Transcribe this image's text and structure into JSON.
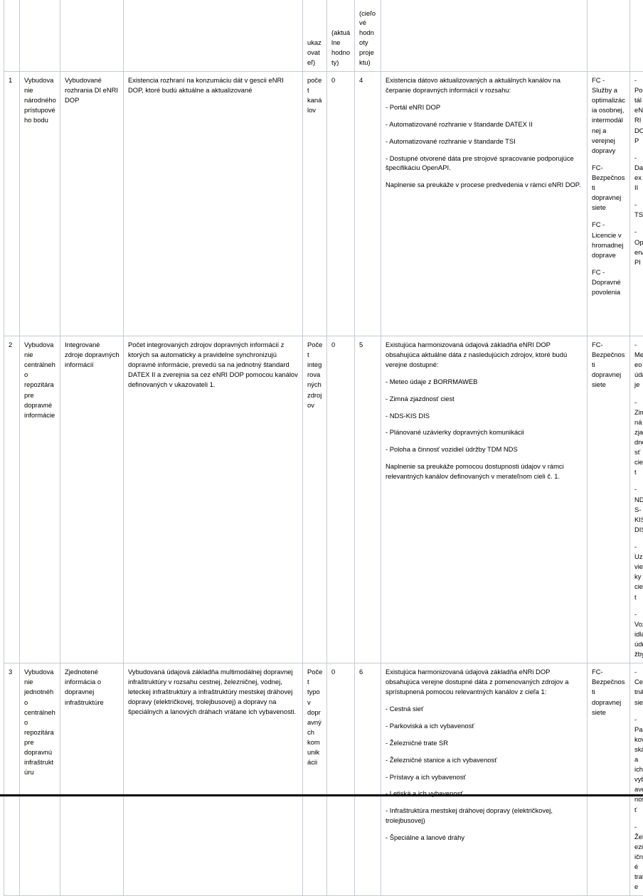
{
  "table": {
    "header": {
      "unit": "ukazovateľ)",
      "baseline": "(aktuálne hodnoty)",
      "target": "(cieľové hodnoty projektu)"
    },
    "rows": [
      {
        "num": "1",
        "goal": "Vybudovanie národného prístupového bodu",
        "name": "Vybudované rozhrania DI eNRI DOP",
        "description": "Existencia rozhraní na konzumáciu dát v gescii eNRI DOP, ktoré budú aktuálne a aktualizované",
        "unit": "počet kanálov",
        "baseline": "0",
        "target": "4",
        "measurement": [
          "Existencia dátovo aktualizovaných a aktuálnych kanálov na čerpanie dopravných informácií v rozsahu:",
          "- Portál eNRI DOP",
          "- Automatizované rozhranie v štandarde DATEX II",
          "- Automatizované rozhranie v štandarde TSI",
          "- Dostupné otvorené dáta pre strojové spracovanie podporujúce špecifikáciu OpenAPI.",
          "Naplnenie sa preukáže v procese predvedenia v rámci eNRI DOP."
        ],
        "fc": [
          "FC - Služby a optimalizácia osobnej, intermodálnej a verejnej dopravy",
          "FC-Bezpečnosti dopravnej siete",
          "FC - Licencie v hromadnej doprave",
          "FC - Dopravné povolenia"
        ],
        "outputs": [
          "- Portál eNRI DOP",
          "- Datex II",
          "- TSI",
          "- OpenAPI"
        ]
      },
      {
        "num": "2",
        "goal": "Vybudovanie centrálneho repozitára pre dopravné informácie",
        "name": "Integrované zdroje dopravných informácií",
        "description": "Počet integrovaných zdrojov dopravných informácií z ktorých sa automaticky a pravidelne synchronizujú dopravné informácie, prevedú sa na jednotný štandard DATEX II a zverejnia sa cez eNRI DOP pomocou kanálov definovaných v ukazovateli 1.",
        "unit": "Počet integrovaných zdrojov",
        "baseline": "0",
        "target": "5",
        "measurement": [
          "Existujúca harmonizovaná údajová základňa eNRI DOP obsahujúca aktuálne dáta z nasledujúcich zdrojov, ktoré budú verejne dostupné:",
          "- Meteo údaje z BORRMAWEB",
          "- Zimná zjazdnosť ciest",
          "- NDS-KIS DIS",
          "- Plánované uzávierky dopravných komunikácii",
          "- Poloha a činnosť vozidiel údržby TDM NDS",
          "Naplnenie sa preukáže pomocou dostupnosti údajov v rámci relevantných kanálov definovaných v merateľnom cieli č. 1."
        ],
        "fc": [
          "FC-Bezpečnosti dopravnej siete"
        ],
        "outputs": [
          "- Meteo údaje",
          "- Zimná zjazdnosť ciest",
          "- NDS-KIS DIS",
          "- Uzávierky ciest",
          "- Vozidlá údržby"
        ]
      },
      {
        "num": "3",
        "goal": "Vybudovanie jednotného centrálneho repozitára pre dopravnú infraštruktúru",
        "name": "Zjednotené informácia o dopravnej infraštruktúre",
        "description": "Vybudovaná údajová základňa multimodálnej dopravnej infraštruktúry v rozsahu cestnej, železničnej, vodnej, leteckej infraštruktúry a infraštruktúry mestskej dráhovej dopravy (električkovej, trolejbusovej) a dopravy na špeciálnych a lanových dráhach vrátane ich vybavenosti.",
        "unit": "Počet typov dopravných komunikácii",
        "baseline": "0",
        "target": "6",
        "measurement": [
          "Existujúca harmonizovaná údajová základňa eNRi DOP obsahujúca verejne dostupné dáta z pomenovaných zdrojov a sprístupnená pomocou relevantných kanálov z cieľa 1:",
          "- Cestná sieť",
          "- Parkoviská a ich vybavenosť",
          "- Železničné trate SR",
          "- Železničné stanice a ich vybavenosť",
          "- Prístavy a ich vybavenosť",
          "- Letiská a ich vybavenosť",
          "- Infraštruktúra mestskej dráhovej dopravy (električkovej, trolejbusovej)",
          "- Špeciálne a lanové dráhy"
        ],
        "fc": [
          "FC-Bezpečnosti dopravnej siete"
        ],
        "outputs": [
          "- Cestná sieť",
          "- Parkoviská a ich vybavenosť",
          "- Železničné trate"
        ]
      }
    ]
  },
  "colors": {
    "grid": "#c3cbd8",
    "accent_blue": "#4472c4",
    "text": "#000000"
  }
}
